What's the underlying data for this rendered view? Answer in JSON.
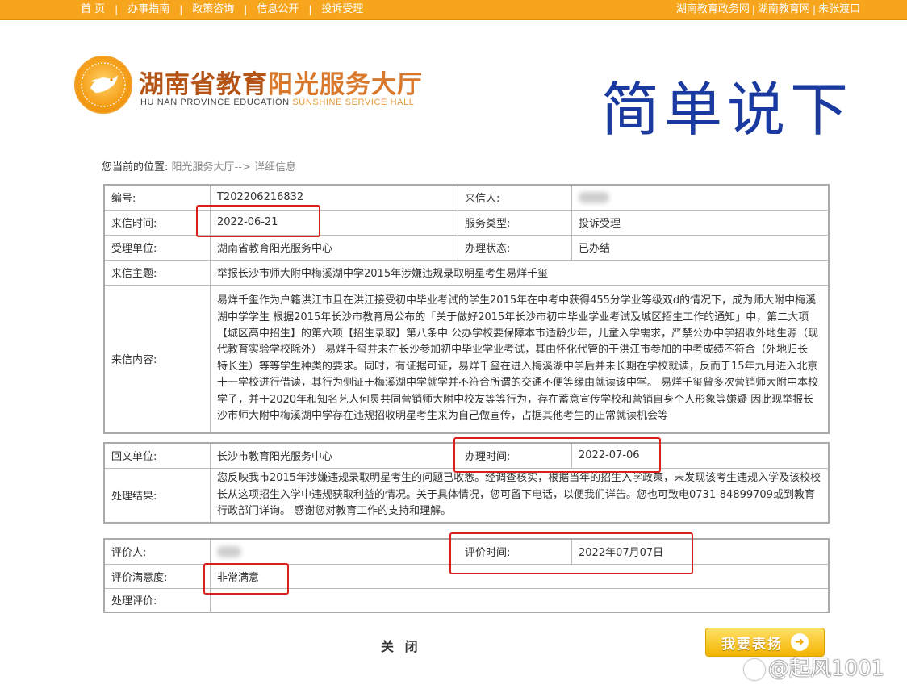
{
  "topnav": {
    "left": [
      "首 页",
      "办事指南",
      "政策咨询",
      "信息公开",
      "投诉受理"
    ],
    "right": [
      "湖南教育政务网",
      "湖南教育网",
      "朱张渡口"
    ]
  },
  "header": {
    "brand_cn_part1": "湖南省教育",
    "brand_cn_part2": "阳光服务大厅",
    "brand_en_part1": "HU NAN PROVINCE EDUCATION ",
    "brand_en_part2": "SUNSHINE SERVICE HALL",
    "overlay_title": "简单说下"
  },
  "breadcrumb": {
    "label": "您当前的位置:",
    "path": "阳光服务大厅--> 详细信息"
  },
  "letter": {
    "id_label": "编号:",
    "id_value": "T202206216832",
    "sender_label": "来信人:",
    "date_label": "来信时间:",
    "date_value": "2022-06-21",
    "type_label": "服务类型:",
    "type_value": "投诉受理",
    "unit_label": "受理单位:",
    "unit_value": "湖南省教育阳光服务中心",
    "status_label": "办理状态:",
    "status_value": "已办结",
    "subject_label": "来信主题:",
    "subject_value": "举报长沙市师大附中梅溪湖中学2015年涉嫌违规录取明星考生易烊千玺",
    "content_label": "来信内容:",
    "content_value": "易烊千玺作为户籍洪江市且在洪江接受初中毕业考试的学生2015年在中考中获得455分学业等级双d的情况下，成为师大附中梅溪湖中学学生 根据2015年长沙市教育局公布的「关于做好2015年长沙市初中毕业学业考试及城区招生工作的通知」中，第二大项【城区高中招生】的第六项【招生录取】第八条中 公办学校要保障本市适龄少年，儿童入学需求，严禁公办中学招收外地生源（现代教育实验学校除外） 易烊千玺并未在长沙参加初中毕业学业考试，其由怀化代管的于洪江市参加的中考成绩不符合（外地归长 特长生）等等学生种类的要求。同时，有证据可证，易烊千玺在进入梅溪湖中学后并未长期在学校就读，反而于15年九月进入北京十一学校进行借读，其行为侧证于梅溪湖中学就学并不符合所谓的交通不便等缘由就读该中学。 易烊千玺曾多次营销师大附中本校学子，并于2020年和知名艺人何炅共同营销师大附中校友等等行为，存在蓄意宣传学校和营销自身个人形象等嫌疑 因此现举报长沙市师大附中梅溪湖中学存在违规招收明星考生来为自己做宣传，占据其他考生的正常就读机会等"
  },
  "reply": {
    "unit_label": "回文单位:",
    "unit_value": "长沙市教育阳光服务中心",
    "time_label": "办理时间:",
    "time_value": "2022-07-06",
    "result_label": "处理结果:",
    "result_value": "您反映我市2015年涉嫌违规录取明星考生的问题已收悉。经调查核实，根据当年的招生入学政策，未发现该考生违规入学及该校校长从这项招生入学中违规获取利益的情况。关于具体情况，您可留下电话，以便我们详告。您也可致电0731-84899709或到教育行政部门详询。 感谢您对教育工作的支持和理解。"
  },
  "evaluation": {
    "evaluator_label": "评价人:",
    "time_label": "评价时间:",
    "time_value": "2022年07月07日",
    "satisfaction_label": "评价满意度:",
    "satisfaction_value": "非常满意",
    "comment_label": "处理评价:"
  },
  "footer": {
    "close_label": "关 闭",
    "praise_label": "我要表扬",
    "watermark": "@起风1001"
  },
  "colors": {
    "topbar": "#f7a51c",
    "annotation_red": "#d9201c",
    "overlay_title_blue": "#1b3aa0"
  }
}
